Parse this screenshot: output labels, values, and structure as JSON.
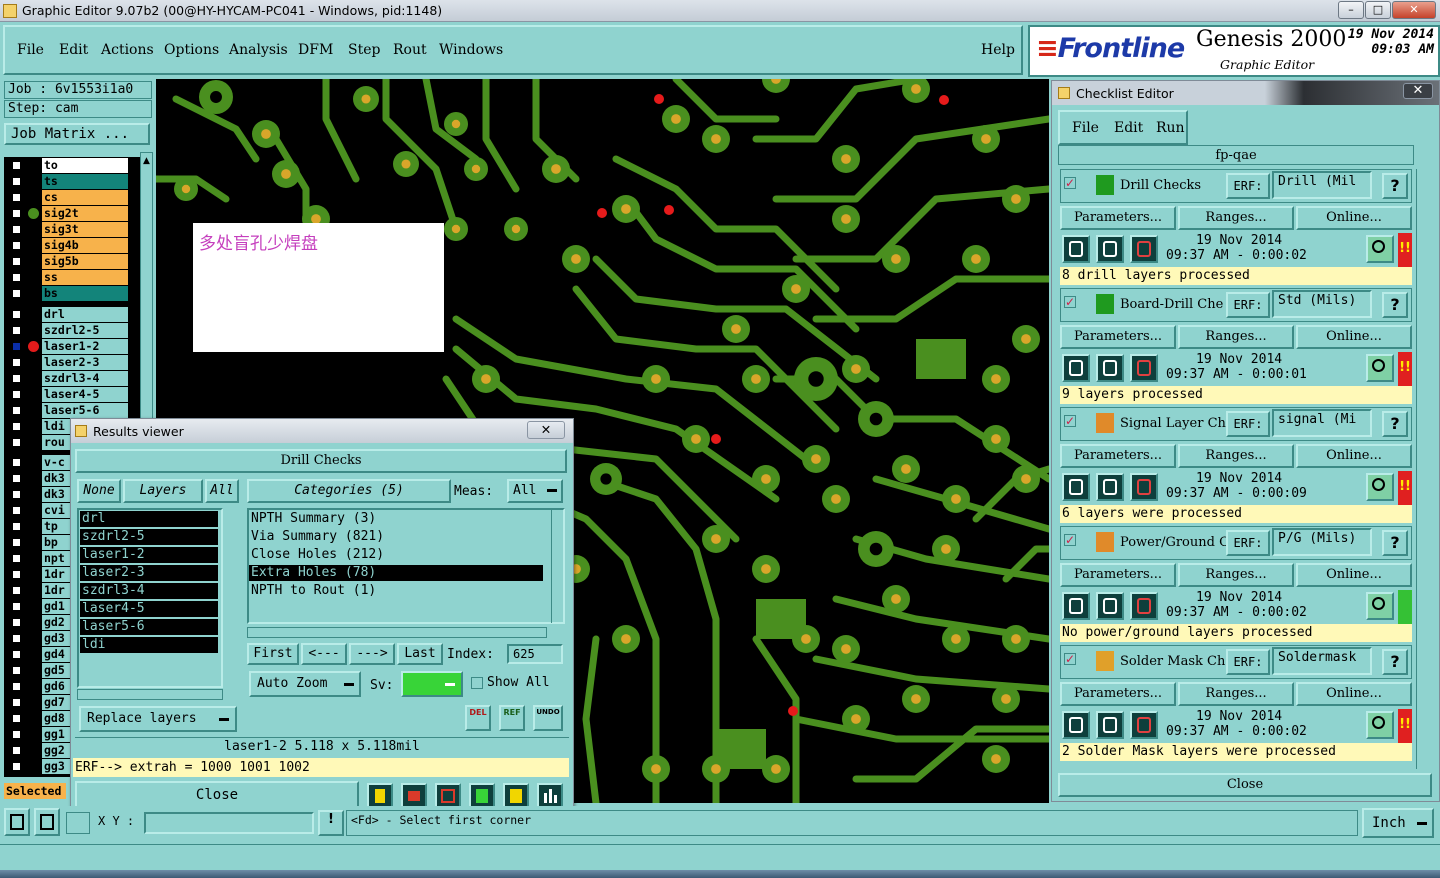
{
  "window": {
    "title": "Graphic Editor 9.07b2 (00@HY-HYCAM-PC041 - Windows, pid:1148)"
  },
  "menu": {
    "items": [
      "File",
      "Edit",
      "Actions",
      "Options",
      "Analysis",
      "DFM",
      "Step",
      "Rout",
      "Windows"
    ],
    "help": "Help"
  },
  "brand": {
    "logo": "Frontline",
    "product": "Genesis 2000",
    "subtitle": "Graphic Editor",
    "date": "19 Nov 2014",
    "time": "09:03 AM"
  },
  "job": {
    "job_line": "Job : 6v1553i1a0",
    "step_line": "Step: cam",
    "matrix_button": "Job Matrix ..."
  },
  "layers": {
    "board": [
      {
        "name": "to",
        "color": "#ffffff"
      },
      {
        "name": "ts",
        "color": "#13847a"
      },
      {
        "name": "cs",
        "color": "#f7b24b"
      },
      {
        "name": "sig2t",
        "color": "#f7b24b"
      },
      {
        "name": "sig3t",
        "color": "#f7b24b"
      },
      {
        "name": "sig4b",
        "color": "#f7b24b"
      },
      {
        "name": "sig5b",
        "color": "#f7b24b"
      },
      {
        "name": "ss",
        "color": "#f7b24b"
      },
      {
        "name": "bs",
        "color": "#13847a"
      }
    ],
    "drill": [
      "drl",
      "szdrl2-5",
      "laser1-2",
      "laser2-3",
      "szdrl3-4",
      "laser4-5",
      "laser5-6",
      "ldi",
      "rou"
    ],
    "misc": [
      "v-c",
      "dk3",
      "dk3",
      "cvi",
      "tp",
      "bp",
      "npt",
      "1dr",
      "1dr",
      "gd1",
      "gd2",
      "gd3",
      "gd4",
      "gd5",
      "gd6",
      "gd7",
      "gd8",
      "gg1",
      "gg2",
      "gg3"
    ],
    "selected_label": "Selected"
  },
  "note": {
    "text": "多处盲孔少焊盘"
  },
  "results": {
    "title": "Results viewer",
    "close_x": "✕",
    "header": "Drill Checks",
    "none_btn": "None",
    "layers_btn": "Layers",
    "all_btn": "All",
    "categories_btn": "Categories (5)",
    "meas_label": "Meas:",
    "meas_value": "All",
    "layer_list": [
      "drl",
      "szdrl2-5",
      "laser1-2",
      "laser2-3",
      "szdrl3-4",
      "laser4-5",
      "laser5-6",
      "ldi"
    ],
    "categories": [
      "NPTH Summary (3)",
      "Via Summary (821)",
      "Close Holes (212)",
      "Extra Holes (78)",
      "NPTH to Rout (1)"
    ],
    "selected_category_index": 3,
    "first": "First",
    "prev": "<---",
    "next": "--->",
    "last": "Last",
    "index_label": "Index:",
    "index_value": "625",
    "auto_zoom": "Auto Zoom",
    "sv_label": "Sv:",
    "show_all": "Show All",
    "replace_layers": "Replace layers",
    "del": "DEL",
    "ref": "REF",
    "undo": "UNDO",
    "measure_line": "laser1-2  5.118 x 5.118mil",
    "erf_line": "ERF--> extrah = 1000 1001 1002",
    "close": "Close"
  },
  "checklist": {
    "title": "Checklist Editor",
    "close_x": "✕",
    "menu": [
      "File",
      "Edit",
      "Run"
    ],
    "name": "fp-qae",
    "erf_label": "ERF:",
    "help_glyph": "?",
    "params": "Parameters...",
    "ranges": "Ranges...",
    "online": "Online...",
    "items": [
      {
        "name": "Drill Checks",
        "erf": "Drill (Mil",
        "date": "19 Nov 2014",
        "time": "09:37 AM - 0:00:02",
        "status": "8 drill layers processed",
        "flag": "#e02020"
      },
      {
        "name": "Board-Drill Che",
        "erf": "Std (Mils)",
        "date": "19 Nov 2014",
        "time": "09:37 AM - 0:00:01",
        "status": "9 layers processed",
        "flag": "#e02020"
      },
      {
        "name": "Signal Layer Ch",
        "erf": "signal (Mi",
        "date": "19 Nov 2014",
        "time": "09:37 AM - 0:00:09",
        "status": "6 layers were processed",
        "flag": "#e02020"
      },
      {
        "name": "Power/Ground C",
        "erf": "P/G (Mils)",
        "date": "19 Nov 2014",
        "time": "09:37 AM - 0:00:02",
        "status": "No power/ground layers processed",
        "flag": "#35c135"
      },
      {
        "name": "Solder Mask Ch",
        "erf": "Soldermask",
        "date": "19 Nov 2014",
        "time": "09:37 AM - 0:00:02",
        "status": "2 Solder Mask layers were processed",
        "flag": "#e02020"
      }
    ],
    "close": "Close"
  },
  "bottom": {
    "xy_label": "X Y :",
    "prompt": "<Fd> - Select first corner",
    "units": "Inch"
  }
}
